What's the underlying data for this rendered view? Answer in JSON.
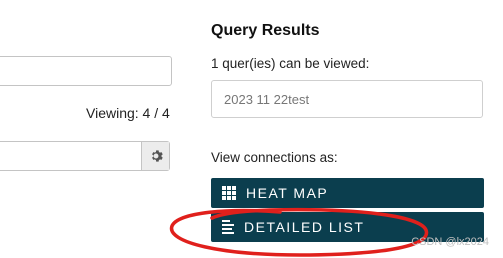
{
  "left_panel": {
    "viewing_label": "Viewing: 4 / 4",
    "settings_icon": "gear-icon"
  },
  "query_results": {
    "title": "Query Results",
    "count_text": "1 quer(ies) can be viewed:",
    "items": [
      "2023 11 22test"
    ]
  },
  "view_connections": {
    "label": "View connections as:",
    "buttons": [
      {
        "label": "HEAT MAP",
        "icon": "grid-icon"
      },
      {
        "label": "DETAILED LIST",
        "icon": "list-icon"
      }
    ],
    "button_color": "#0b3e4e"
  },
  "annotation": {
    "color": "#e0201c",
    "shape": "hand-drawn ellipse around detailed list button"
  },
  "watermark": "CSDN @lx2024"
}
